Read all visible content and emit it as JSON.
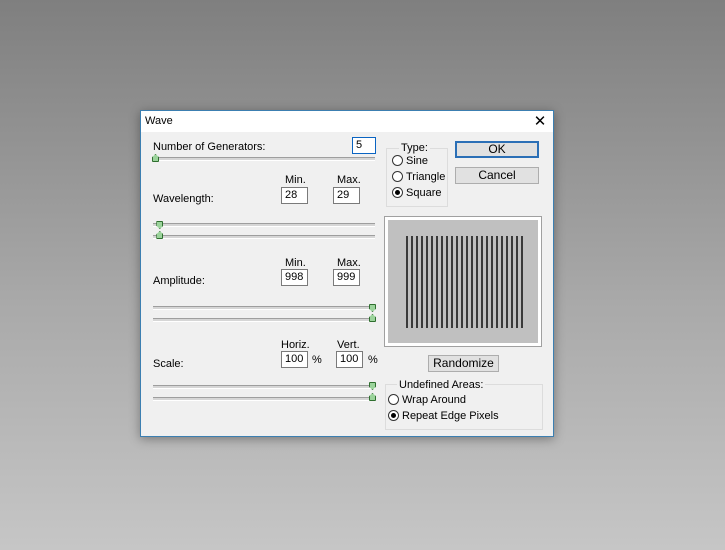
{
  "dialog": {
    "title": "Wave",
    "close_glyph": "✕",
    "number_of_generators": {
      "label": "Number of Generators:",
      "value": "5",
      "level": 0.0
    },
    "wavelength": {
      "label": "Wavelength:",
      "min_label": "Min.",
      "max_label": "Max.",
      "min_value": "28",
      "max_value": "29",
      "min_level": 0.02,
      "max_level": 0.02
    },
    "amplitude": {
      "label": "Amplitude:",
      "min_label": "Min.",
      "max_label": "Max.",
      "min_value": "998",
      "max_value": "999",
      "min_level": 1.0,
      "max_level": 1.0
    },
    "scale": {
      "label": "Scale:",
      "horiz_label": "Horiz.",
      "vert_label": "Vert.",
      "horiz_value": "100",
      "vert_value": "100",
      "percent": "%",
      "horiz_level": 1.0,
      "vert_level": 1.0
    },
    "type": {
      "label": "Type:",
      "options": [
        "Sine",
        "Triangle",
        "Square"
      ],
      "selected": "Square"
    },
    "buttons": {
      "ok": "OK",
      "cancel": "Cancel",
      "randomize": "Randomize"
    },
    "undefined_areas": {
      "label": "Undefined Areas:",
      "options": [
        "Wrap Around",
        "Repeat Edge Pixels"
      ],
      "selected": "Repeat Edge Pixels"
    }
  },
  "colors": {
    "accent": "#2b6fb6",
    "slider_thumb": "#9bd39b",
    "window_border": "#3c7fb1"
  },
  "icons": {
    "close": "close-icon",
    "preview": "wave-preview"
  }
}
